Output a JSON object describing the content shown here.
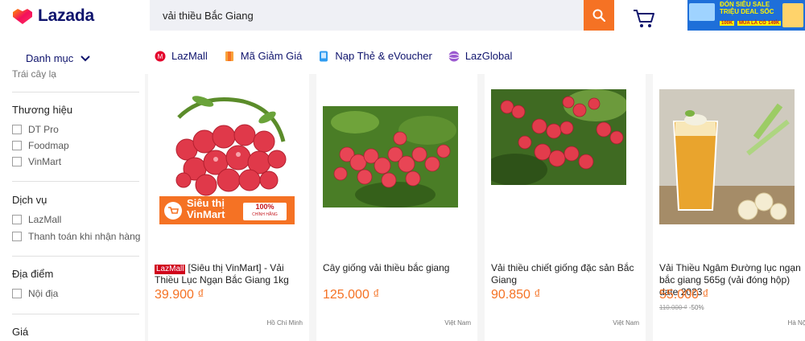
{
  "header": {
    "brand": "Lazada",
    "search_value": "vải thiều Bắc Giang",
    "promo": {
      "line1": "ĐÓN SIÊU SALE",
      "line2": "TRIỆU DEAL SỐC",
      "b1": "100K",
      "b2": "MUA LÀ CÓ QUÀ",
      "b3": "149K"
    }
  },
  "nav": {
    "category": "Danh mục",
    "links": [
      {
        "label": "LazMall",
        "icon": "lazmall-icon"
      },
      {
        "label": "Mã Giảm Giá",
        "icon": "voucher-icon"
      },
      {
        "label": "Nạp Thẻ & eVoucher",
        "icon": "topup-icon"
      },
      {
        "label": "LazGlobal",
        "icon": "lazglobal-icon"
      }
    ]
  },
  "sidebar": {
    "cut_item": "Trái cây lạ",
    "brand_title": "Thương hiệu",
    "brands": [
      "DT Pro",
      "Foodmap",
      "VinMart"
    ],
    "service_title": "Dịch vụ",
    "services": [
      "LazMall",
      "Thanh toán khi nhận hàng"
    ],
    "location_title": "Địa điểm",
    "locations": [
      "Nội địa"
    ],
    "price_title": "Giá"
  },
  "products": [
    {
      "badge": "LazMall",
      "title": "[Siêu thị VinMart] - Vải Thiều Lục Ngạn Bắc Giang 1kg",
      "price": "39.900 ₫",
      "location": "Hồ Chí Minh",
      "banner_title": "Siêu thị VinMart",
      "banner_tag": "100%",
      "banner_sub": "CHÍNH HÃNG"
    },
    {
      "title": "Cây giống vải thiều bắc giang",
      "price": "125.000 ₫",
      "location": "Việt Nam"
    },
    {
      "title": "Vải thiều chiết giống đặc sản Bắc Giang",
      "price": "90.850 ₫",
      "location": "Việt Nam"
    },
    {
      "title": "Vải Thiều Ngâm Đường lục ngạn bắc giang 565g (vải đóng hộp) date 2023",
      "price": "55.000 ₫",
      "original_price": "110.000 ₫",
      "discount": "-50%",
      "location": "Hà Nội"
    }
  ],
  "colors": {
    "accent": "#f57224",
    "brand_navy": "#0f146d",
    "lazmall_red": "#d0011b"
  }
}
